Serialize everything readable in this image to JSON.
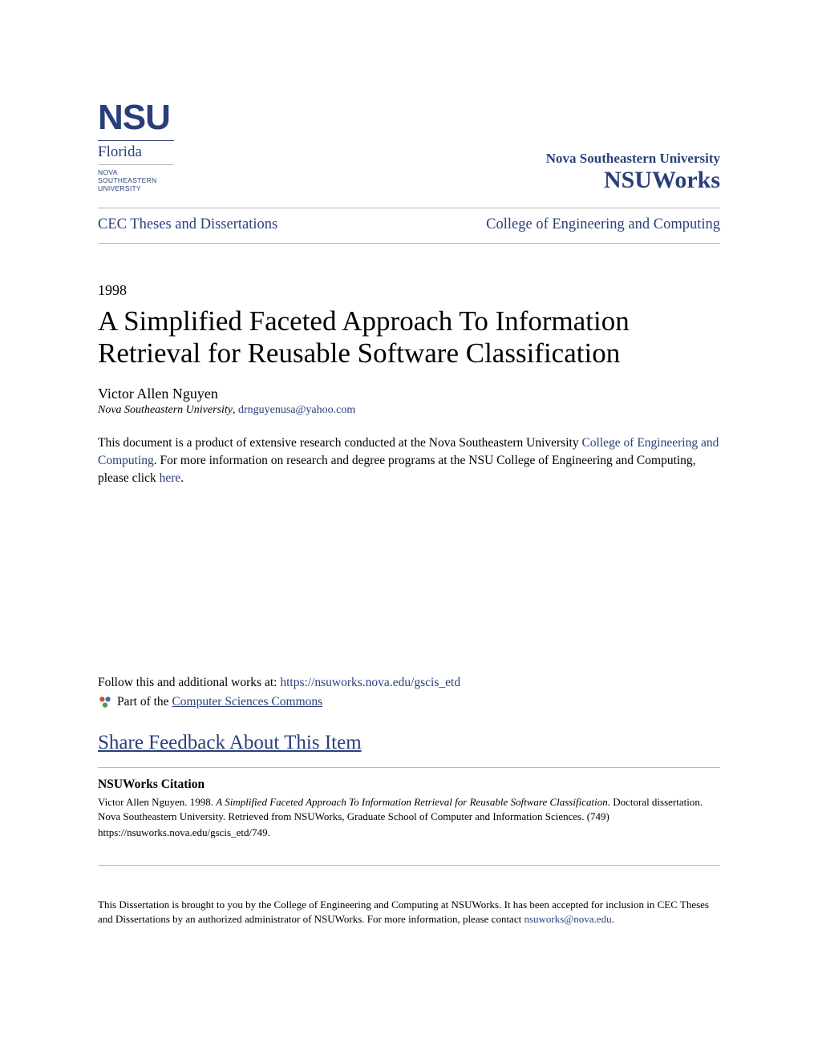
{
  "logo": {
    "nsu": "NSU",
    "florida": "Florida",
    "sub": "NOVA SOUTHEASTERN UNIVERSITY"
  },
  "repo": {
    "university": "Nova Southeastern University",
    "name": "NSUWorks"
  },
  "nav": {
    "left": "CEC Theses and Dissertations",
    "right": "College of Engineering and Computing"
  },
  "year": "1998",
  "title": "A Simplified Faceted Approach To Information Retrieval for Reusable Software Classification",
  "author": "Victor Allen Nguyen",
  "affiliation": "Nova Southeastern University",
  "email": "drnguyenusa@yahoo.com",
  "intro": {
    "part1": "This document is a product of extensive research conducted at the Nova Southeastern University ",
    "link1": "College of Engineering and Computing",
    "part2": ". For more information on research and degree programs at the NSU College of Engineering and Computing, please click ",
    "link2": "here",
    "part3": "."
  },
  "follow": {
    "label": "Follow this and additional works at: ",
    "url": "https://nsuworks.nova.edu/gscis_etd"
  },
  "partof": {
    "label": " Part of the ",
    "link": "Computer Sciences Commons"
  },
  "feedback": "Share Feedback About This Item",
  "citation": {
    "heading": "NSUWorks Citation",
    "author_year": "Victor Allen Nguyen. 1998. ",
    "title_italic": "A Simplified Faceted Approach To Information Retrieval for Reusable Software Classification.",
    "rest": " Doctoral dissertation. Nova Southeastern University. Retrieved from NSUWorks, Graduate School of Computer and Information Sciences. (749)",
    "url": "https://nsuworks.nova.edu/gscis_etd/749."
  },
  "footer": {
    "text1": "This Dissertation is brought to you by the College of Engineering and Computing at NSUWorks. It has been accepted for inclusion in CEC Theses and Dissertations by an authorized administrator of NSUWorks. For more information, please contact ",
    "email": "nsuworks@nova.edu",
    "text2": "."
  }
}
